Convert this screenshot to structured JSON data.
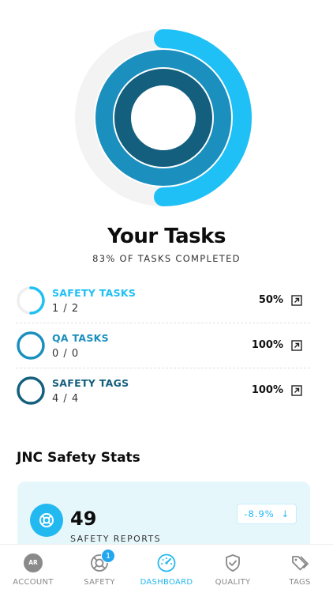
{
  "header": {
    "title": "Your Tasks",
    "subtitle": "83% OF TASKS COMPLETED"
  },
  "rings": {
    "outer_fraction": 0.5,
    "middle_fraction": 1.0,
    "inner_fraction": 1.0,
    "colors": {
      "outer": "#1ec0f5",
      "middle": "#1b8fbe",
      "inner": "#135f7d",
      "track": "#f3f3f3"
    }
  },
  "tasks": [
    {
      "name": "SAFETY TASKS",
      "count": "1 / 2",
      "percent": "50%",
      "fraction": 0.5,
      "color": "#1ec0f5"
    },
    {
      "name": "QA TASKS",
      "count": "0 / 0",
      "percent": "100%",
      "fraction": 1.0,
      "color": "#1b8fbe"
    },
    {
      "name": "SAFETY TAGS",
      "count": "4 / 4",
      "percent": "100%",
      "fraction": 1.0,
      "color": "#135f7d"
    }
  ],
  "stats": {
    "title": "JNC Safety Stats",
    "value": "49",
    "label": "SAFETY REPORTS",
    "change": "-8.9%",
    "change_arrow": "↓"
  },
  "tabbar": {
    "account_label": "ACCOUNT",
    "account_initials": "AR",
    "safety_label": "SAFETY",
    "safety_badge": "1",
    "dashboard_label": "DASHBOARD",
    "quality_label": "QUALITY",
    "tags_label": "TAGS",
    "active_tab": "dashboard",
    "colors": {
      "active": "#22b8f0",
      "inactive": "#888888"
    }
  }
}
